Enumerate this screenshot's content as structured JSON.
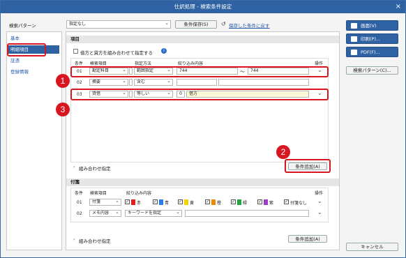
{
  "window": {
    "title": "仕訳処理 - 検索条件設定",
    "close": "×"
  },
  "top": {
    "pattern_label": "検索パターン",
    "pattern_value": "指定なし",
    "save_button": "条件保存(S)",
    "restore_link": "保存した条件に戻す"
  },
  "sidebar": {
    "items": [
      {
        "label": "基本"
      },
      {
        "label": "明細項目"
      },
      {
        "label": "証憑"
      },
      {
        "label": "登録情報"
      }
    ]
  },
  "right_buttons": {
    "screen": "画面(V)",
    "print": "印刷(P)...",
    "pdf": "PDF(F)...",
    "search_pattern": "検索パターン(C)...",
    "cancel": "キャンセル"
  },
  "items_section": {
    "title": "項目",
    "combine_check": "借方と貸方を組み合わせて指定する",
    "headers": {
      "condition": "条件",
      "item": "検索項目",
      "method": "指定方法",
      "content": "絞り込み内容",
      "op": "操作"
    },
    "rows": [
      {
        "num": "01",
        "item": "勘定科目",
        "method": "範囲指定",
        "from": "744",
        "tilde": "〜",
        "to": "744"
      },
      {
        "num": "02",
        "item": "摘要",
        "method": "含む",
        "from": "",
        "tilde": "",
        "to": ""
      },
      {
        "num": "03",
        "item": "貸借",
        "method": "等しい",
        "from": "0",
        "tilde": "",
        "to": "借方"
      }
    ],
    "add_button": "条件追加(A)",
    "combo_label": "組み合わせ指定"
  },
  "memo_section": {
    "title": "付箋",
    "headers": {
      "condition": "条件",
      "item": "検索項目",
      "content": "絞り込み内容",
      "op": "操作"
    },
    "rows": [
      {
        "num": "01",
        "item": "付箋"
      },
      {
        "num": "02",
        "item": "メモ内容",
        "method": "キーワードを指定"
      }
    ],
    "colors": [
      {
        "label": "赤",
        "hex": "#e02020"
      },
      {
        "label": "青",
        "hex": "#2a7de1"
      },
      {
        "label": "黄",
        "hex": "#f5d200"
      },
      {
        "label": "橙",
        "hex": "#f08a00"
      },
      {
        "label": "緑",
        "hex": "#23a33a"
      },
      {
        "label": "紫",
        "hex": "#9b3fc7"
      }
    ],
    "none_label": "付箋なし",
    "add_button": "条件追加(A)",
    "combo_label": "組み合わせ指定"
  },
  "callouts": [
    "1",
    "2",
    "3"
  ]
}
